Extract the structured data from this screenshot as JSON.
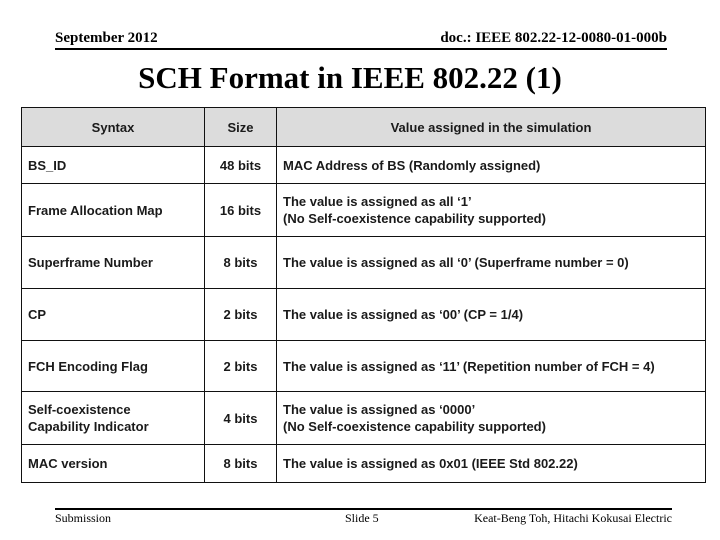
{
  "header": {
    "date": "September 2012",
    "doc_id": "doc.: IEEE 802.22-12-0080-01-000b"
  },
  "slide_title": "SCH Format in IEEE 802.22 (1)",
  "table": {
    "columns": [
      "Syntax",
      "Size",
      "Value assigned in the simulation"
    ],
    "rows": [
      {
        "syntax": "BS_ID",
        "size": "48 bits",
        "value": "MAC Address of BS (Randomly assigned)"
      },
      {
        "syntax": "Frame Allocation Map",
        "size": "16 bits",
        "value": "The value is assigned as all ‘1’\n(No Self-coexistence capability supported)"
      },
      {
        "syntax": "Superframe Number",
        "size": "8 bits",
        "value": "The value is assigned as all ‘0’ (Superframe number = 0)"
      },
      {
        "syntax": "CP",
        "size": "2 bits",
        "value": "The value is assigned as ‘00’ (CP = 1/4)"
      },
      {
        "syntax": "FCH Encoding Flag",
        "size": "2 bits",
        "value": "The value is assigned as ‘11’ (Repetition number of FCH = 4)"
      },
      {
        "syntax": "Self-coexistence\nCapability Indicator",
        "size": "4 bits",
        "value": "The value is assigned as ‘0000’\n(No Self-coexistence capability supported)"
      },
      {
        "syntax": "MAC version",
        "size": "8 bits",
        "value": "The value is assigned as 0x01 (IEEE Std 802.22)"
      }
    ]
  },
  "footer": {
    "left": "Submission",
    "center": "Slide 5",
    "right": "Keat-Beng Toh, Hitachi Kokusai Electric"
  },
  "colors": {
    "header_row_bg": "#dcdcdc",
    "border": "#111111",
    "text": "#1a1a1a"
  }
}
